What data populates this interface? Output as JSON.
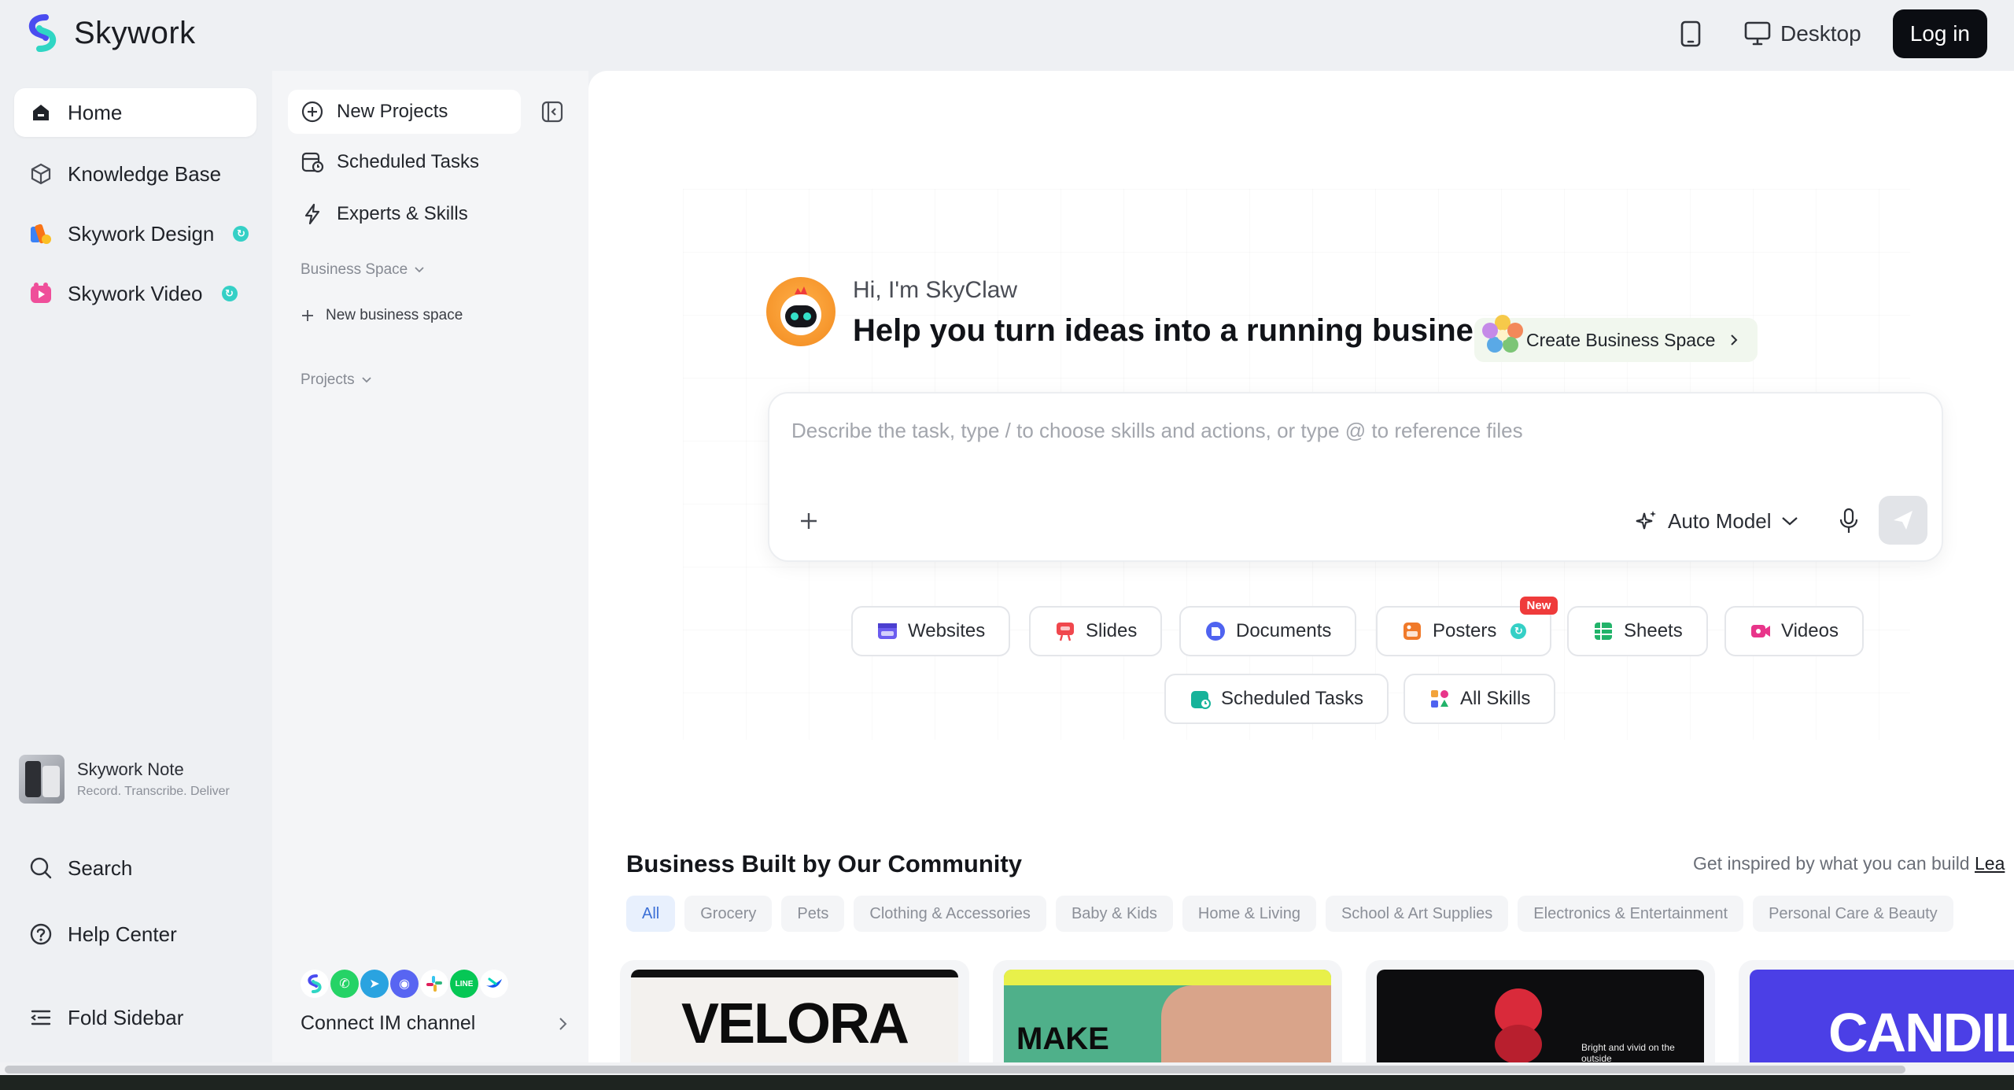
{
  "brand": {
    "name": "Skywork"
  },
  "topbar": {
    "desktop_label": "Desktop",
    "login_label": "Log in"
  },
  "sidebar": {
    "items": [
      {
        "label": "Home",
        "icon": "home-icon"
      },
      {
        "label": "Knowledge Base",
        "icon": "cube-icon"
      },
      {
        "label": "Skywork Design",
        "icon": "design-app-icon"
      },
      {
        "label": "Skywork Video",
        "icon": "video-app-icon"
      }
    ],
    "note": {
      "title": "Skywork Note",
      "subtitle": "Record. Transcribe. Deliver"
    },
    "bottom": [
      {
        "label": "Search",
        "icon": "search-icon"
      },
      {
        "label": "Help Center",
        "icon": "help-icon"
      },
      {
        "label": "Fold Sidebar",
        "icon": "fold-icon"
      }
    ]
  },
  "panel": {
    "new_projects": "New Projects",
    "scheduled_tasks": "Scheduled Tasks",
    "experts_skills": "Experts & Skills",
    "business_space": "Business Space",
    "new_business_space": "New business space",
    "projects": "Projects",
    "connect_im": "Connect IM channel"
  },
  "hero": {
    "greeting": "Hi, I'm SkyClaw",
    "headline": "Help you turn ideas into a running business",
    "create_space": "Create Business Space"
  },
  "composer": {
    "placeholder": "Describe the task, type / to choose skills and actions, or type @ to reference files",
    "model": "Auto Model"
  },
  "skills": [
    {
      "label": "Websites",
      "color": "#6b5cf0"
    },
    {
      "label": "Slides",
      "color": "#f0474d"
    },
    {
      "label": "Documents",
      "color": "#4f63f0"
    },
    {
      "label": "Posters",
      "color": "#f07a2a",
      "tag": "New"
    },
    {
      "label": "Sheets",
      "color": "#22b36a"
    },
    {
      "label": "Videos",
      "color": "#e8358a"
    },
    {
      "label": "Scheduled Tasks",
      "color": "#16b39a"
    },
    {
      "label": "All Skills",
      "color": "#f2a33a"
    }
  ],
  "community": {
    "title": "Business Built by Our Community",
    "subtitle": "Get inspired by what you can build",
    "link": "Lea",
    "categories": [
      "All",
      "Grocery",
      "Pets",
      "Clothing & Accessories",
      "Baby & Kids",
      "Home & Living",
      "School & Art Supplies",
      "Electronics & Entertainment",
      "Personal Care & Beauty"
    ],
    "cards": [
      {
        "title": "VELORA"
      },
      {
        "title": "MAKE"
      },
      {
        "title": "Bright and vivid on the outside"
      },
      {
        "title": "CANDIL"
      }
    ]
  }
}
